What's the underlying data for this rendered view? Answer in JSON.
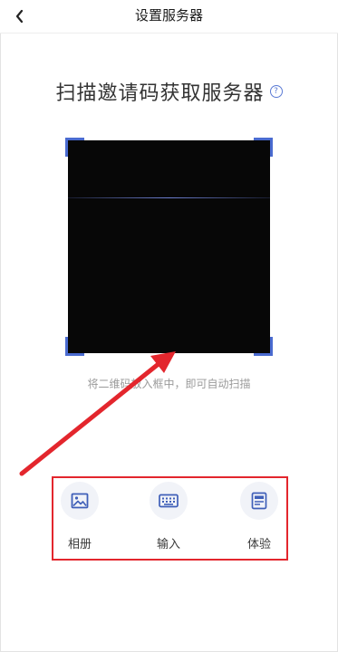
{
  "nav": {
    "back_icon": "chevron-left-icon",
    "title": "设置服务器"
  },
  "main": {
    "headline": "扫描邀请码获取服务器",
    "help_icon_glyph": "?",
    "hint": "将二维码放入框中，即可自动扫描"
  },
  "actions": [
    {
      "label": "相册",
      "icon": "image-icon"
    },
    {
      "label": "输入",
      "icon": "keyboard-icon"
    },
    {
      "label": "体验",
      "icon": "server-icon"
    }
  ],
  "colors": {
    "accent": "#4a6bd0",
    "annotation": "#e3262d",
    "scan_area": "#070707"
  }
}
